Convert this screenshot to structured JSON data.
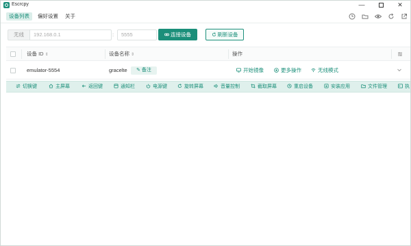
{
  "window": {
    "title": "Escrcpy",
    "controls": [
      "minimize",
      "maximize",
      "close"
    ]
  },
  "nav": {
    "tabs": [
      {
        "label": "设备列表",
        "active": true
      },
      {
        "label": "偏好设置",
        "active": false
      },
      {
        "label": "关于",
        "active": false
      }
    ],
    "icons": [
      "clock-icon",
      "folder-icon",
      "eye-icon",
      "refresh-icon",
      "external-link-icon"
    ]
  },
  "connection": {
    "tag": "无线",
    "ip_placeholder": "192.168.0.1",
    "colon": ":",
    "port_placeholder": "5555",
    "connect_label": "连接设备",
    "refresh_label": "刷新设备"
  },
  "table": {
    "headers": {
      "device_id": "设备 ID",
      "device_name": "设备名称",
      "actions": "操作",
      "sort_indicator": "⇕"
    },
    "rows": [
      {
        "device_id": "emulator-5554",
        "device_name": "gracelte",
        "remark_label": "备注",
        "ops": [
          "开始镜像",
          "更多操作",
          "无线模式"
        ]
      }
    ]
  },
  "controls_bar": {
    "items": [
      {
        "label": "切换键",
        "icon": "switch-icon"
      },
      {
        "label": "主屏幕",
        "icon": "home-icon"
      },
      {
        "label": "返回键",
        "icon": "back-icon"
      },
      {
        "label": "通知栏",
        "icon": "notification-icon"
      },
      {
        "label": "电源键",
        "icon": "power-icon"
      },
      {
        "label": "旋转屏幕",
        "icon": "rotate-icon"
      },
      {
        "label": "音量控制",
        "icon": "volume-icon"
      },
      {
        "label": "截取屏幕",
        "icon": "crop-icon"
      },
      {
        "label": "重启设备",
        "icon": "restart-icon"
      },
      {
        "label": "安装应用",
        "icon": "install-icon"
      },
      {
        "label": "文件管理",
        "icon": "file-icon"
      },
      {
        "label": "执",
        "icon": "terminal-icon"
      }
    ]
  },
  "colors": {
    "accent": "#1b8f7a",
    "accent_light": "#dff0ec",
    "border": "#eceff0"
  }
}
